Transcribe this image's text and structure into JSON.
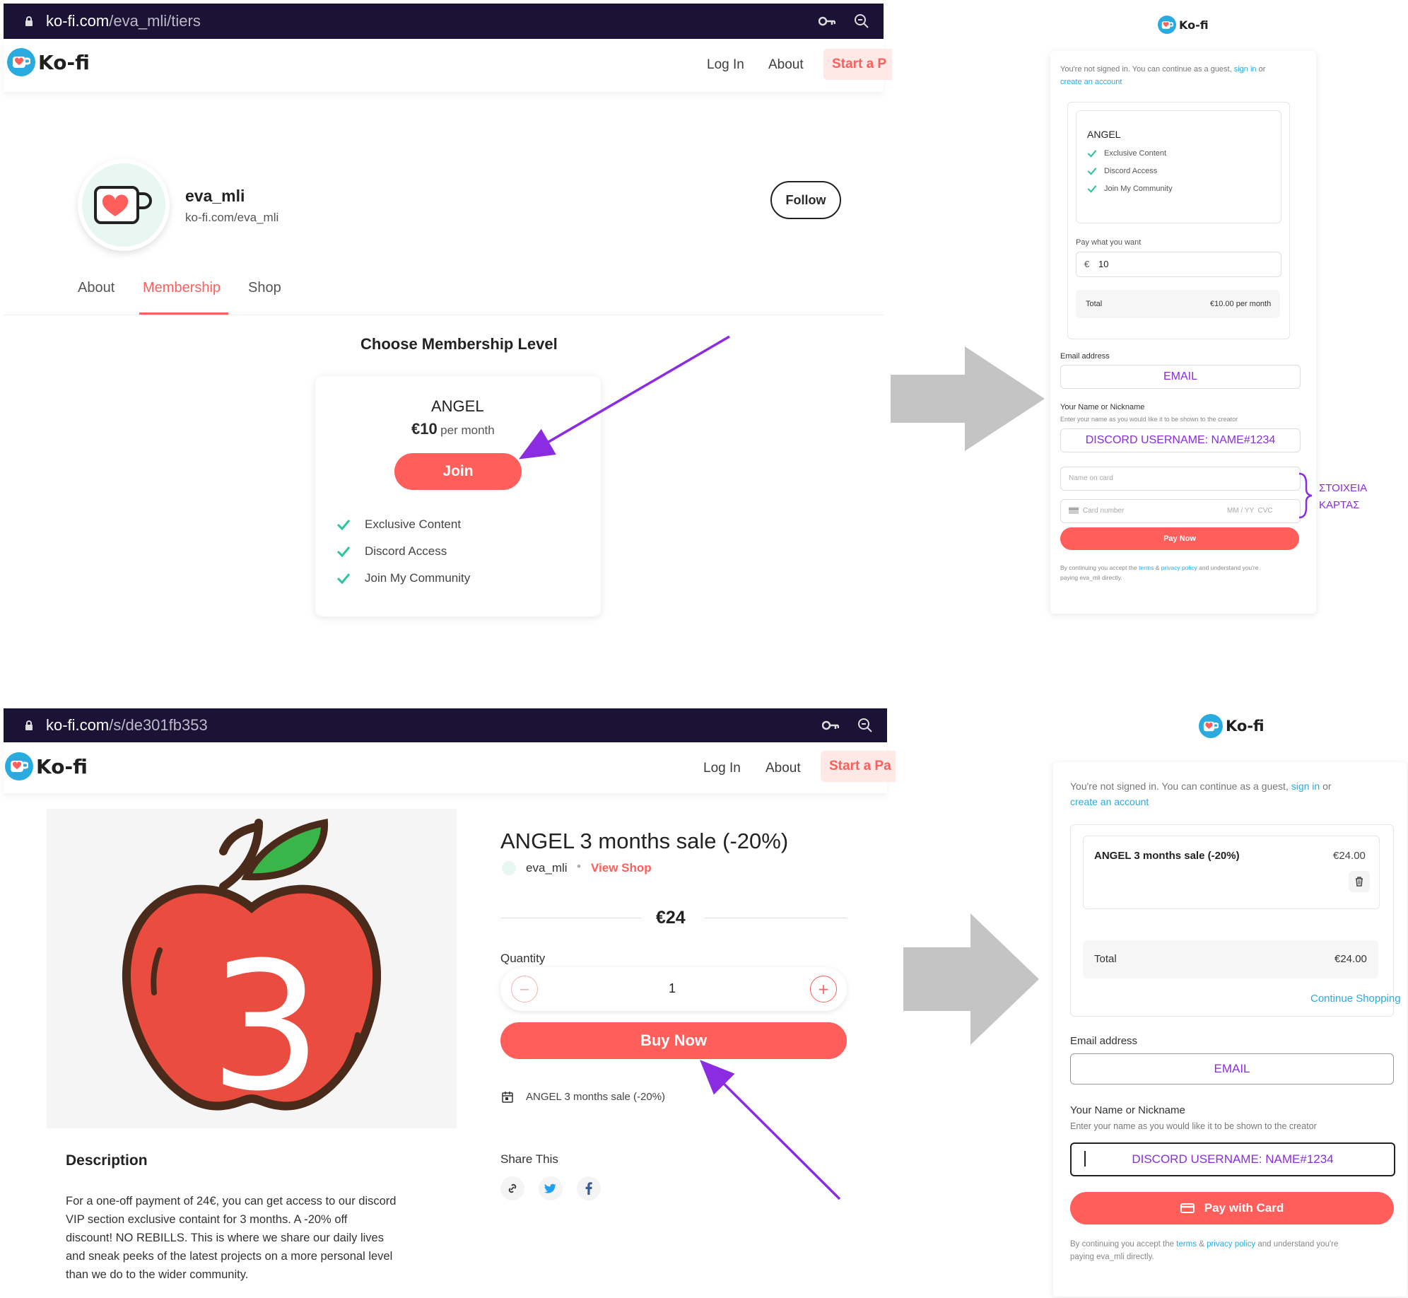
{
  "panel1": {
    "url_host": "ko-fi.com",
    "url_path": "/eva_mli/tiers",
    "brand": "Ko-fi",
    "nav_login": "Log In",
    "nav_about": "About",
    "nav_start": "Start a P",
    "username": "eva_mli",
    "profile_url": "ko-fi.com/eva_mli",
    "follow": "Follow",
    "tabs": [
      "About",
      "Membership",
      "Shop"
    ],
    "heading": "Choose Membership Level",
    "tier_name": "ANGEL",
    "tier_price": "€10",
    "tier_period": "per month",
    "join": "Join",
    "features": [
      "Exclusive Content",
      "Discord Access",
      "Join My Community"
    ]
  },
  "panel2": {
    "brand": "Ko-fi",
    "notice_prefix": "You're not signed in. You can continue as a guest,",
    "sign_in": "sign in",
    "or": "or",
    "create_account": "create an account",
    "tier_name": "ANGEL",
    "features": [
      "Exclusive Content",
      "Discord Access",
      "Join My Community"
    ],
    "pay_label": "Pay what you want",
    "currency": "€",
    "amount": "10",
    "total_label": "Total",
    "total_value": "€10.00 per month",
    "email_label": "Email address",
    "email_value": "EMAIL",
    "name_label": "Your Name or Nickname",
    "name_hint": "Enter your name as you would like it to be shown to the creator",
    "name_value": "DISCORD USERNAME: NAME#1234",
    "card_name_placeholder": "Name on card",
    "card_number_placeholder": "Card number",
    "card_exp": "MM / YY  CVC",
    "annotation_line1": "ΣΤΟΙΧΕΙΑ",
    "annotation_line2": "ΚΑΡΤΑΣ",
    "pay_now": "Pay Now",
    "footer_pre": "By continuing you accept the",
    "terms": "terms",
    "amp": "&",
    "privacy": "privacy policy",
    "footer_post": "and understand you're",
    "footer_line2": "paying eva_mli directly."
  },
  "panel3": {
    "url_host": "ko-fi.com",
    "url_path": "/s/de301fb353",
    "brand": "Ko-fi",
    "nav_login": "Log In",
    "nav_about": "About",
    "nav_start": "Start a Pa",
    "product_title": "ANGEL 3 months sale (-20%)",
    "seller": "eva_mli",
    "view_shop": "View Shop",
    "price": "€24",
    "quantity_label": "Quantity",
    "quantity_value": "1",
    "buy_now": "Buy Now",
    "item_line": "ANGEL 3 months sale (-20%)",
    "share_label": "Share This",
    "apple_number": "3",
    "description_title": "Description",
    "description_lines": [
      "For a one-off payment of 24€, you can get access to our discord",
      "VIP section exclusive containt for 3 months. A -20% off",
      "discount! NO REBILLS. This is where we share our daily lives",
      "and sneak peeks of the latest projects on a more personal level",
      "than we do to the wider community."
    ]
  },
  "panel4": {
    "brand": "Ko-fi",
    "notice_prefix": "You're not signed in. You can continue as a guest,",
    "sign_in": "sign in",
    "or": "or",
    "create_account": "create an account",
    "item_name": "ANGEL 3 months sale (-20%)",
    "item_price": "€24.00",
    "total_label": "Total",
    "total_value": "€24.00",
    "continue_shopping": "Continue Shopping",
    "email_label": "Email address",
    "email_value": "EMAIL",
    "name_label": "Your Name or Nickname",
    "name_hint": "Enter your name as you would like it to be shown to the creator",
    "name_value": "DISCORD USERNAME: NAME#1234",
    "pay_card": "Pay with Card",
    "footer_pre": "By continuing you accept the",
    "terms": "terms",
    "amp": "&",
    "privacy": "privacy policy",
    "footer_post": "and understand you're",
    "footer_line2": "paying eva_mli directly."
  },
  "colors": {
    "brand_red": "#ff5e5b",
    "brand_blue": "#29abe0",
    "annotation_purple": "#8b2be2",
    "url_bar": "#1b1335",
    "check_green": "#2ec4a0"
  }
}
